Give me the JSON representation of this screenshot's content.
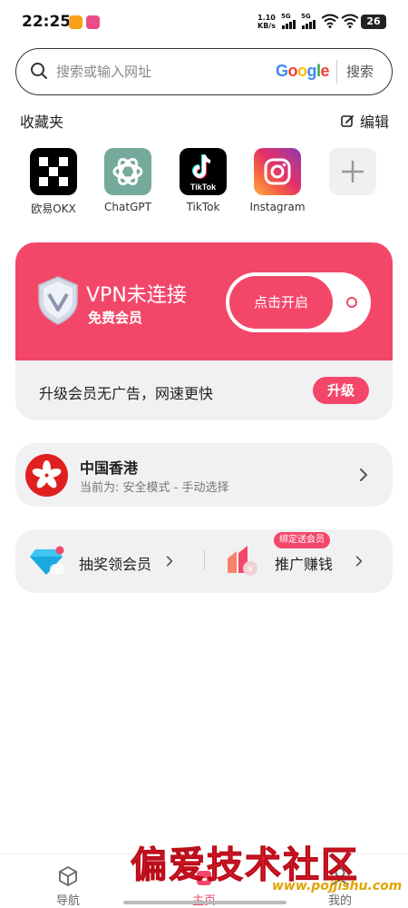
{
  "status_bar": {
    "time": "22:25",
    "net_speed_value": "1.10",
    "net_speed_unit": "KB/s",
    "signal1": "5G",
    "signal2": "5G",
    "battery": "26"
  },
  "search": {
    "placeholder": "搜索或输入网址",
    "engine_letters": [
      "G",
      "o",
      "o",
      "g",
      "l",
      "e"
    ],
    "button": "搜索"
  },
  "favorites": {
    "title": "收藏夹",
    "edit": "编辑",
    "items": [
      {
        "label": "欧易OKX",
        "icon": "okx-icon"
      },
      {
        "label": "ChatGPT",
        "icon": "chatgpt-icon"
      },
      {
        "label": "TikTok",
        "icon": "tiktok-icon"
      },
      {
        "label": "Instagram",
        "icon": "instagram-icon"
      }
    ]
  },
  "vpn": {
    "title": "VPN未连接",
    "subtitle": "免费会员",
    "connect_button": "点击开启",
    "upgrade_text": "升级会员无广告，网速更快",
    "upgrade_button": "升级"
  },
  "region": {
    "name": "中国香港",
    "current": "当前为: 安全模式 - 手动选择"
  },
  "promo": {
    "lottery": "抽奖领会员",
    "referral": "推广赚钱",
    "badge": "绑定送会员"
  },
  "nav": {
    "items": [
      "导航",
      "主页",
      "我的"
    ]
  },
  "watermark": {
    "title": "偏爱技术社区",
    "url": "www.pojjishu.com"
  },
  "colors": {
    "accent": "#f3476a",
    "card_bg": "#f1f1f3"
  }
}
